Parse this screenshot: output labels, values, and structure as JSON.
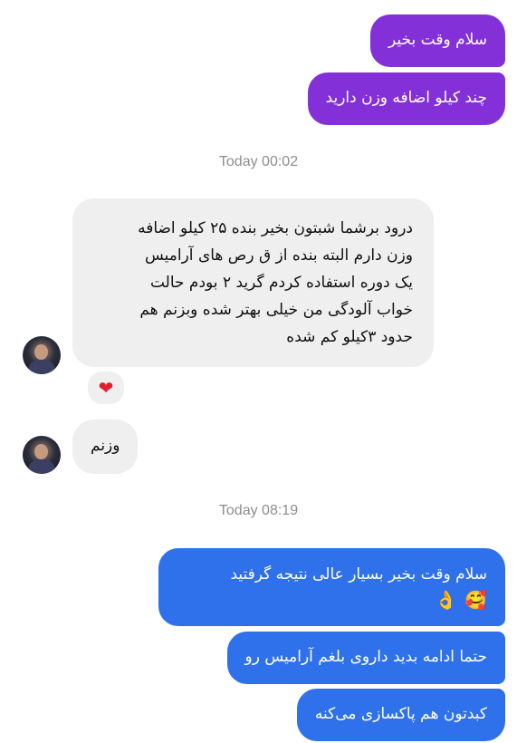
{
  "messages": {
    "sent_1": "سلام وقت بخیر",
    "sent_2": "چند کیلو اضافه وزن دارید",
    "timestamp_1": "Today 00:02",
    "received_1_lines": [
      "درود برشما شبتون بخیر بنده ۲۵ کیلو اضافه",
      "وزن دارم البته بنده از ق رص های آرامیس",
      "یک دوره استفاده کردم گرید ۲ بودم حالت",
      "خواب آلودگی من خیلی بهتر شده وبزنم هم",
      "حدود ۳کیلو کم شده"
    ],
    "reaction": "❤",
    "received_2": "وزنم",
    "timestamp_2": "Today 08:19",
    "sent_3": "سلام وقت بخیر بسیار عالی نتیجه گرفتید",
    "sent_3_emojis": [
      "🥰",
      "👌"
    ],
    "sent_4": "حتما ادامه بدید داروی بلغم آرامیس رو",
    "sent_5": "کبدتون هم پاکسازی می‌کنه"
  },
  "colors": {
    "sent_purple": "#8430d9",
    "sent_blue": "#2e71ea",
    "received_gray": "#efefef",
    "timestamp": "#8e8e8e",
    "heart": "#e0202f"
  }
}
